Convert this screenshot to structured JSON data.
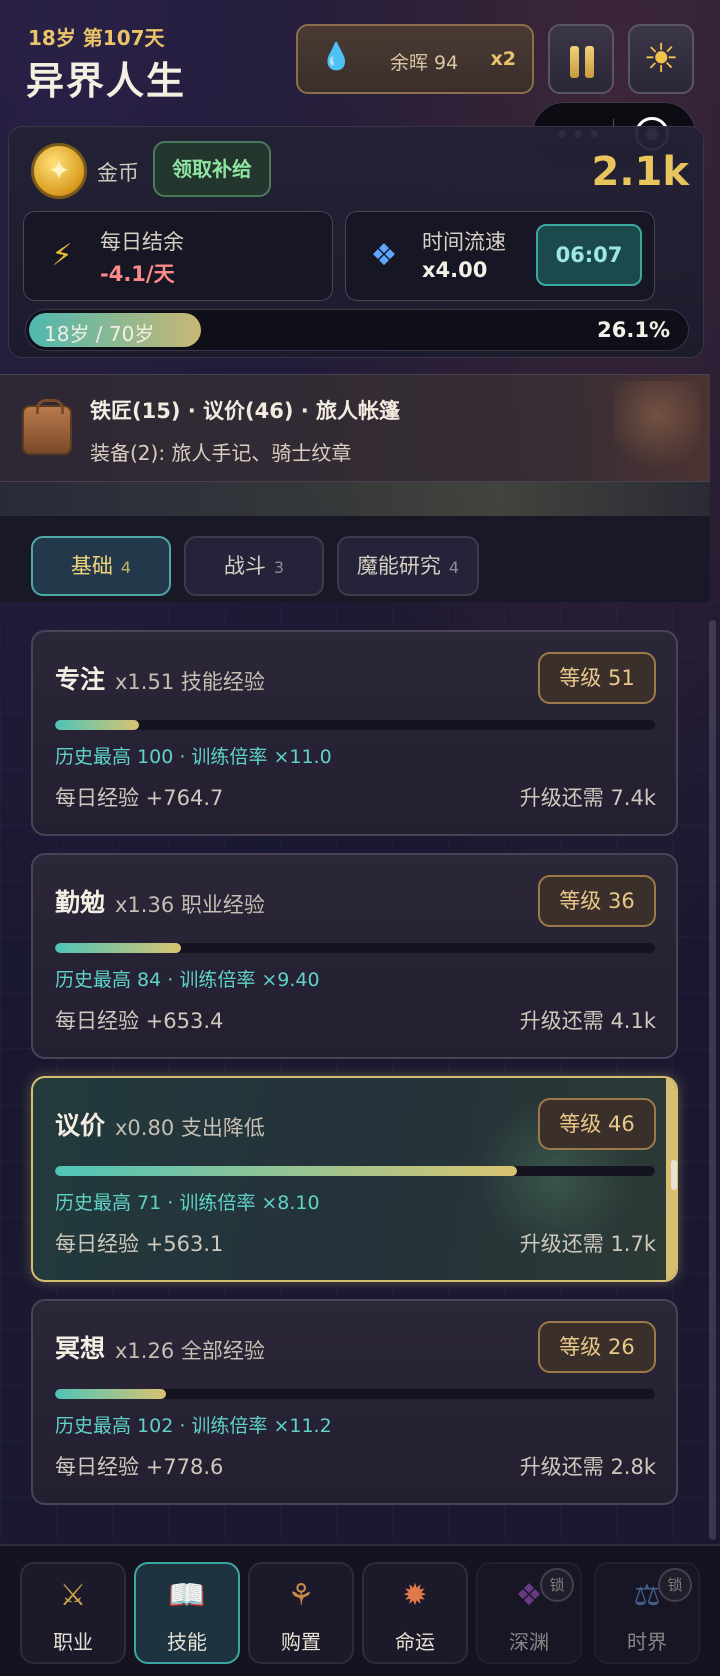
{
  "header": {
    "age_day": "18岁 第107天",
    "title": "异界人生",
    "ember_label": "余晖 94",
    "ember_multiplier": "x2",
    "icons": {
      "ember": "flame-icon",
      "pause": "pause-icon",
      "settings": "sun-gear-icon"
    }
  },
  "mini_capsule": {
    "more": "•••",
    "close": "target-icon"
  },
  "status": {
    "coin_label": "金币",
    "claim_button": "领取补给",
    "gold_amount": "2.1k",
    "daily_balance": {
      "label": "每日结余",
      "value": "-4.1/天",
      "color": "#ff8a8a"
    },
    "time_speed": {
      "label": "时间流速",
      "value": "x4.00",
      "timer": "06:07"
    },
    "life": {
      "text": "18岁 / 70岁",
      "percent_text": "26.1%",
      "fraction": 0.261
    }
  },
  "inventory": {
    "line1": "铁匠(15) · 议价(46) · 旅人帐篷",
    "line2": "装备(2): 旅人手记、骑士纹章"
  },
  "tabs": [
    {
      "label": "基础",
      "count": "4",
      "active": true
    },
    {
      "label": "战斗",
      "count": "3",
      "active": false
    },
    {
      "label": "魔能研究",
      "count": "4",
      "active": false
    }
  ],
  "skills": [
    {
      "name": "专注",
      "mult": "x1.51 技能经验",
      "level": "等级 51",
      "progress": 0.14,
      "history": "历史最高 100 · 训练倍率 ×11.0",
      "daily": "每日经验 +764.7",
      "need": "升级还需 7.4k",
      "highlight": false
    },
    {
      "name": "勤勉",
      "mult": "x1.36 职业经验",
      "level": "等级 36",
      "progress": 0.21,
      "history": "历史最高 84 · 训练倍率 ×9.40",
      "daily": "每日经验 +653.4",
      "need": "升级还需 4.1k",
      "highlight": false
    },
    {
      "name": "议价",
      "mult": "x0.80 支出降低",
      "level": "等级 46",
      "progress": 0.77,
      "history": "历史最高 71 · 训练倍率 ×8.10",
      "daily": "每日经验 +563.1",
      "need": "升级还需 1.7k",
      "highlight": true
    },
    {
      "name": "冥想",
      "mult": "x1.26 全部经验",
      "level": "等级 26",
      "progress": 0.185,
      "history": "历史最高 102 · 训练倍率 ×11.2",
      "daily": "每日经验 +778.6",
      "need": "升级还需 2.8k",
      "highlight": false
    }
  ],
  "nav": [
    {
      "label": "职业",
      "icon": "shield-sword-icon",
      "active": false,
      "locked": false
    },
    {
      "label": "技能",
      "icon": "spellbook-icon",
      "active": true,
      "locked": false
    },
    {
      "label": "购置",
      "icon": "merchant-bag-icon",
      "active": false,
      "locked": false
    },
    {
      "label": "命运",
      "icon": "fate-wheel-icon",
      "active": false,
      "locked": false
    },
    {
      "label": "深渊",
      "icon": "abyss-crystal-icon",
      "active": false,
      "locked": true,
      "lock_label": "锁"
    },
    {
      "label": "时界",
      "icon": "time-tower-icon",
      "active": false,
      "locked": true,
      "lock_label": "锁"
    }
  ]
}
